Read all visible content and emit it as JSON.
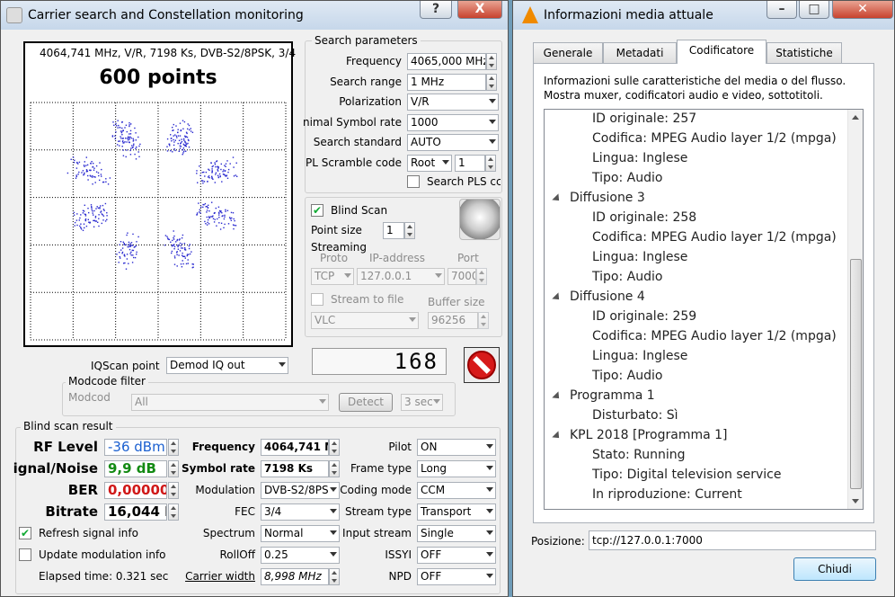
{
  "left_window": {
    "title": "Carrier search and Constellation monitoring",
    "help_btn": "?",
    "close_btn": "X",
    "constellation": {
      "info": "4064,741 MHz, V/R, 7198 Ks, DVB-S2/8PSK, 3/4",
      "points": "600 points",
      "dot_color": "#2a2ad0"
    },
    "search": {
      "group": "Search parameters",
      "frequency_label": "Frequency",
      "frequency": "4065,000 MHz",
      "range_label": "Search range",
      "range": "1 MHz",
      "polarization_label": "Polarization",
      "polarization": "V/R",
      "min_sr_label": "nimal Symbol rate",
      "min_sr": "1000",
      "standard_label": "Search standard",
      "standard": "AUTO",
      "pls_label": "PL Scramble code",
      "pls_mode": "Root",
      "pls_value": "1",
      "search_pls": "Search PLS cc"
    },
    "blind": {
      "label": "Blind Scan",
      "point_size_label": "Point size",
      "point_size": "1"
    },
    "streaming": {
      "label": "Streaming",
      "proto_label": "Proto",
      "ip_label": "IP-address",
      "port_label": "Port",
      "proto": "TCP",
      "ip": "127.0.0.1",
      "port": "7000",
      "stream_file": "Stream to file",
      "buffer_label": "Buffer size",
      "player": "VLC",
      "buffer": "96256"
    },
    "counter": "168",
    "iqscan": {
      "label": "IQScan point",
      "value": "Demod IQ out"
    },
    "modcode": {
      "group": "Modcode filter",
      "label": "Modcode",
      "value": "All",
      "detect": "Detect",
      "sec": "3 sec"
    },
    "result": {
      "group": "Blind scan result",
      "rf_label": "RF Level",
      "rf": "-36 dBm",
      "snr_label": "ignal/Noise",
      "snr": "9,9 dB",
      "ber_label": "BER",
      "ber": "0,00000",
      "bitrate_label": "Bitrate",
      "bitrate": "16,044 M",
      "freq_label": "Frequency",
      "freq": "4064,741 M",
      "sr_label": "Symbol rate",
      "sr": "7198 Ks",
      "mod_label": "Modulation",
      "mod": "DVB-S2/8PS",
      "fec_label": "FEC",
      "fec": "3/4",
      "spectrum_label": "Spectrum",
      "spectrum": "Normal",
      "rolloff_label": "RollOff",
      "rolloff": "0.25",
      "cw_label": "Carrier width",
      "cw": "8,998 MHz",
      "pilot_label": "Pilot",
      "pilot": "ON",
      "frame_label": "Frame type",
      "frame": "Long",
      "coding_label": "Coding mode",
      "coding": "CCM",
      "stype_label": "Stream type",
      "stype": "Transport",
      "istream_label": "Input stream",
      "istream": "Single",
      "issyi_label": "ISSYI",
      "issyi": "OFF",
      "npd_label": "NPD",
      "npd": "OFF",
      "refresh": "Refresh signal info",
      "update_mod": "Update modulation info",
      "elapsed": "Elapsed time: 0.321 sec",
      "rf_color": "#1a5fd0",
      "snr_color": "#138a13",
      "ber_color": "#d01818"
    }
  },
  "right_window": {
    "title": "Informazioni media attuale",
    "tabs": [
      "Generale",
      "Metadati",
      "Codificatore",
      "Statistiche"
    ],
    "desc1": "Informazioni sulle caratteristiche del media o del flusso.",
    "desc2": "Mostra muxer, codificatori audio e video, sottotitoli.",
    "tree": [
      {
        "t": "ID originale: 257",
        "lvl": 1
      },
      {
        "t": "Codifica: MPEG Audio layer 1/2 (mpga)",
        "lvl": 1
      },
      {
        "t": "Lingua: Inglese",
        "lvl": 1
      },
      {
        "t": "Tipo: Audio",
        "lvl": 1
      },
      {
        "t": "Diffusione 3",
        "lvl": 0
      },
      {
        "t": "ID originale: 258",
        "lvl": 1
      },
      {
        "t": "Codifica: MPEG Audio layer 1/2 (mpga)",
        "lvl": 1
      },
      {
        "t": "Lingua: Inglese",
        "lvl": 1
      },
      {
        "t": "Tipo: Audio",
        "lvl": 1
      },
      {
        "t": "Diffusione 4",
        "lvl": 0
      },
      {
        "t": "ID originale: 259",
        "lvl": 1
      },
      {
        "t": "Codifica: MPEG Audio layer 1/2 (mpga)",
        "lvl": 1
      },
      {
        "t": "Lingua: Inglese",
        "lvl": 1
      },
      {
        "t": "Tipo: Audio",
        "lvl": 1
      },
      {
        "t": "Programma 1",
        "lvl": 0
      },
      {
        "t": "Disturbato: Sì",
        "lvl": 1
      },
      {
        "t": "KPL 2018 [Programma 1]",
        "lvl": 0
      },
      {
        "t": "Stato: Running",
        "lvl": 1
      },
      {
        "t": "Tipo: Digital television service",
        "lvl": 1
      },
      {
        "t": "In riproduzione: Current",
        "lvl": 1
      }
    ],
    "position_label": "Posizione:",
    "position": "tcp://127.0.0.1:7000",
    "close": "Chiudi"
  }
}
